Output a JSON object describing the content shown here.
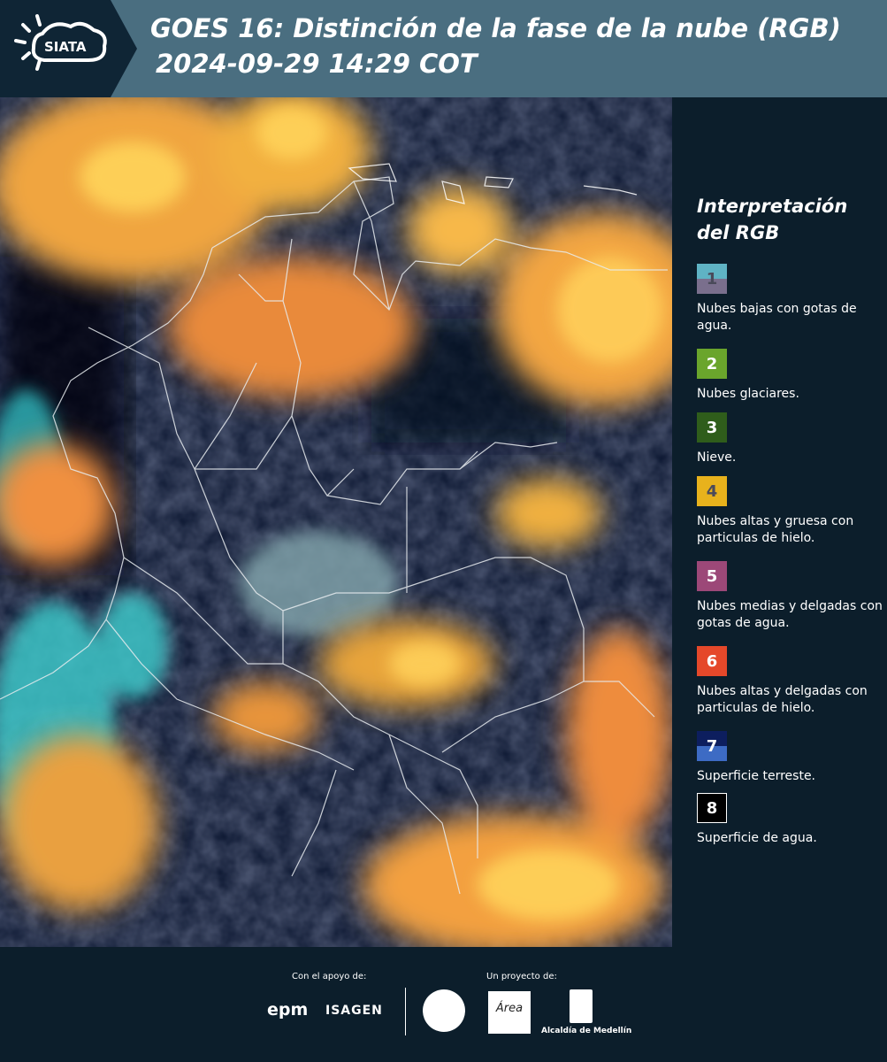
{
  "header": {
    "title": "GOES 16: Distinción de la fase de la nube (RGB)",
    "subtitle": "2024-09-29 14:29 COT",
    "logo_text": "SIATA",
    "logo_icon": "sun-cloud-icon"
  },
  "legend": {
    "title": "Interpretación del RGB",
    "items": [
      {
        "num": "1",
        "label": "Nubes bajas con gotas de agua.",
        "color_top": "#5fb3c4",
        "color_bottom": "#7a6f8d"
      },
      {
        "num": "2",
        "label": "Nubes glaciares.",
        "color_top": "#6aa52c",
        "color_bottom": "#6aa52c"
      },
      {
        "num": "3",
        "label": "Nieve.",
        "color_top": "#2f5d1b",
        "color_bottom": "#2f5d1b"
      },
      {
        "num": "4",
        "label": "Nubes altas y gruesa con particulas de hielo.",
        "color_top": "#e8b21c",
        "color_bottom": "#e8b21c"
      },
      {
        "num": "5",
        "label": "Nubes medias y delgadas con gotas de agua.",
        "color_top": "#9c4878",
        "color_bottom": "#9c4878"
      },
      {
        "num": "6",
        "label": "Nubes altas y delgadas con particulas de hielo.",
        "color_top": "#e5482a",
        "color_bottom": "#e5482a"
      },
      {
        "num": "7",
        "label": "Superficie terreste.",
        "color_top": "#0d1e5e",
        "color_bottom": "#3d6bc4"
      },
      {
        "num": "8",
        "label": "Superficie de agua.",
        "color_top": "#000000",
        "color_bottom": "#000000"
      }
    ]
  },
  "footer": {
    "support_label": "Con el apoyo de:",
    "project_label": "Un proyecto de:",
    "epm": "epm",
    "isagen": "ISAGEN",
    "area_logo": "Área",
    "alcaldia": "Alcaldía de Medellín"
  }
}
